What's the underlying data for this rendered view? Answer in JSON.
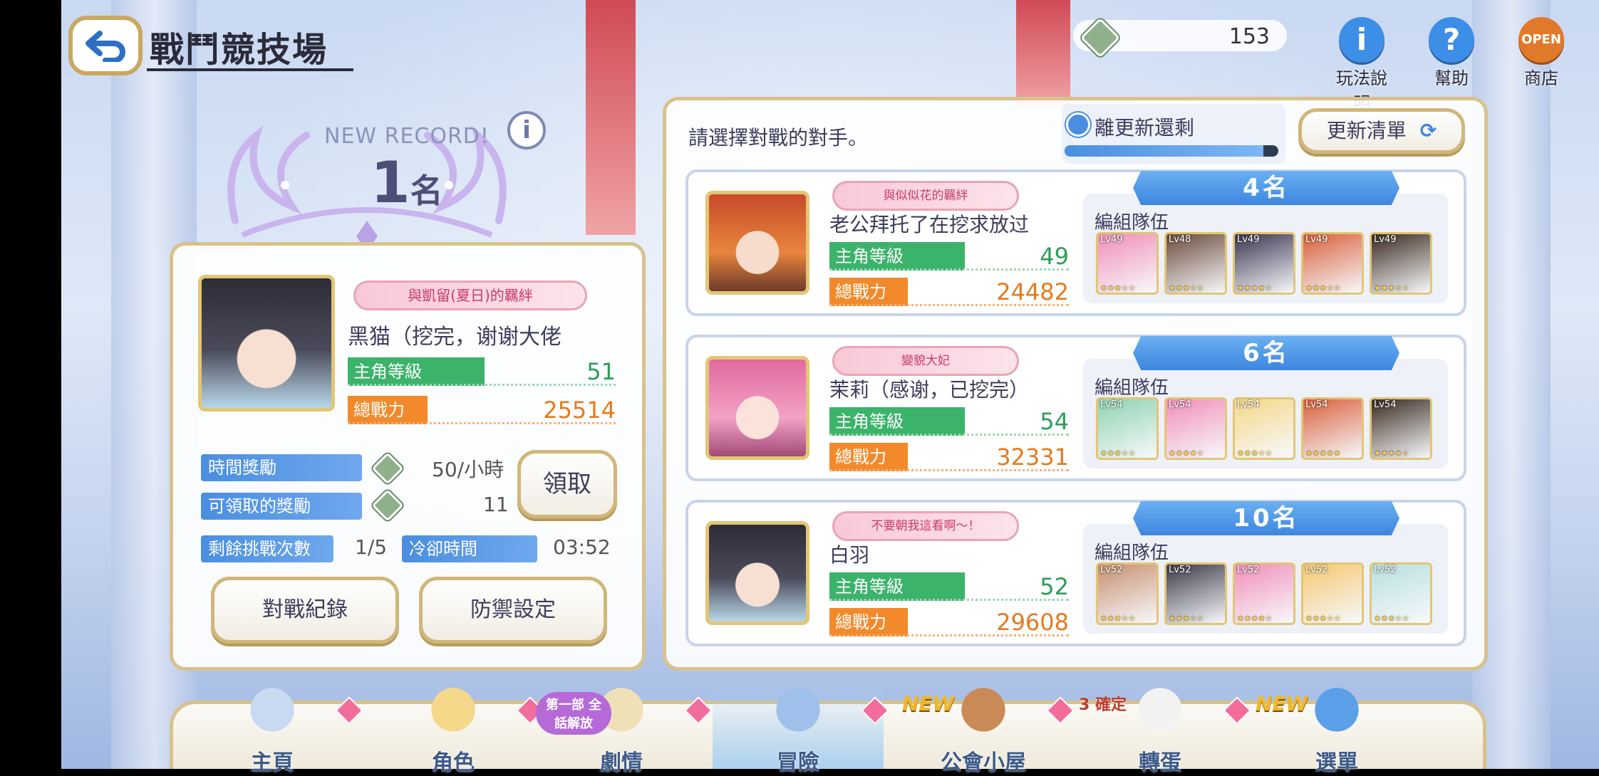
{
  "header": {
    "title": "戰鬥競技場",
    "currency_value": "153"
  },
  "top_icons": [
    {
      "label": "玩法說明",
      "glyph": "i",
      "color": "#3d8ee6"
    },
    {
      "label": "幫助",
      "glyph": "?",
      "color": "#3d8ee6"
    },
    {
      "label": "商店",
      "glyph": "OPEN",
      "color": "#e07a2a"
    }
  ],
  "record": {
    "new_record": "NEW RECORD!",
    "rank": "1",
    "rank_unit": "名"
  },
  "player": {
    "bond": "與凱留(夏日)的羈絆",
    "name": "黑猫（挖完，谢谢大佬",
    "level_label": "主角等級",
    "level": "51",
    "power_label": "總戰力",
    "power": "25514",
    "time_reward_label": "時間獎勵",
    "time_reward": "50/小時",
    "claimable_label": "可領取的獎勵",
    "claimable": "11",
    "claim_button": "領取",
    "challenges_label": "剩餘挑戰次數",
    "challenges": "1/5",
    "cooldown_label": "冷卻時間",
    "cooldown": "03:52",
    "history_button": "對戰紀錄",
    "defense_button": "防禦設定"
  },
  "opponents_panel": {
    "instruction": "請選擇對戰的對手。",
    "timer_label": "離更新還剩",
    "timer_progress": 0.93,
    "refresh_button": "更新清單"
  },
  "opponents": [
    {
      "rank": "4名",
      "bond": "與似似花的羈絆",
      "name": "老公拜托了在挖求放过",
      "level_label": "主角等級",
      "level": "49",
      "power_label": "總戰力",
      "power": "24482",
      "team_label": "編組隊伍",
      "units": [
        {
          "lv": "Lv49",
          "stars": "★★★☆☆",
          "color": "#f08fb8"
        },
        {
          "lv": "Lv48",
          "stars": "★★★☆☆",
          "color": "#6a4a3a"
        },
        {
          "lv": "Lv49",
          "stars": "★★★★☆",
          "color": "#3a3550"
        },
        {
          "lv": "Lv49",
          "stars": "★★★☆☆",
          "color": "#d8603a"
        },
        {
          "lv": "Lv49",
          "stars": "★★★☆☆",
          "color": "#3a2a20"
        }
      ]
    },
    {
      "rank": "6名",
      "bond": "變貌大妃",
      "name": "茉莉（感谢，已挖完）",
      "level_label": "主角等級",
      "level": "54",
      "power_label": "總戰力",
      "power": "32331",
      "team_label": "編組隊伍",
      "units": [
        {
          "lv": "Lv54",
          "stars": "★★★☆☆",
          "color": "#8fd3b0"
        },
        {
          "lv": "Lv54",
          "stars": "★★★★☆",
          "color": "#f08fb8"
        },
        {
          "lv": "Lv54",
          "stars": "★★★☆☆",
          "color": "#f5d88a"
        },
        {
          "lv": "Lv54",
          "stars": "★★★★★",
          "color": "#d8603a"
        },
        {
          "lv": "Lv54",
          "stars": "★★★★☆",
          "color": "#3a2a20"
        }
      ]
    },
    {
      "rank": "10名",
      "bond": "不要朝我這看啊～！",
      "name": "白羽",
      "level_label": "主角等級",
      "level": "52",
      "power_label": "總戰力",
      "power": "29608",
      "team_label": "編組隊伍",
      "units": [
        {
          "lv": "Lv52",
          "stars": "★★★☆☆",
          "color": "#c89070"
        },
        {
          "lv": "Lv52",
          "stars": "★★★☆☆",
          "color": "#3a3a48"
        },
        {
          "lv": "Lv52",
          "stars": "★★★★☆",
          "color": "#f08fb8"
        },
        {
          "lv": "Lv52",
          "stars": "★★★☆☆",
          "color": "#f5c870"
        },
        {
          "lv": "Lv52",
          "stars": "★★★☆☆",
          "color": "#b8e0e0"
        }
      ]
    }
  ],
  "nav": [
    {
      "label": "主頁",
      "badge": ""
    },
    {
      "label": "角色",
      "badge": ""
    },
    {
      "label": "劇情",
      "badge": "第一部 全話解放"
    },
    {
      "label": "冒險",
      "badge": ""
    },
    {
      "label": "公會小屋",
      "badge": "NEW"
    },
    {
      "label": "轉蛋",
      "badge": "3 確定"
    },
    {
      "label": "選單",
      "badge": "NEW"
    }
  ]
}
